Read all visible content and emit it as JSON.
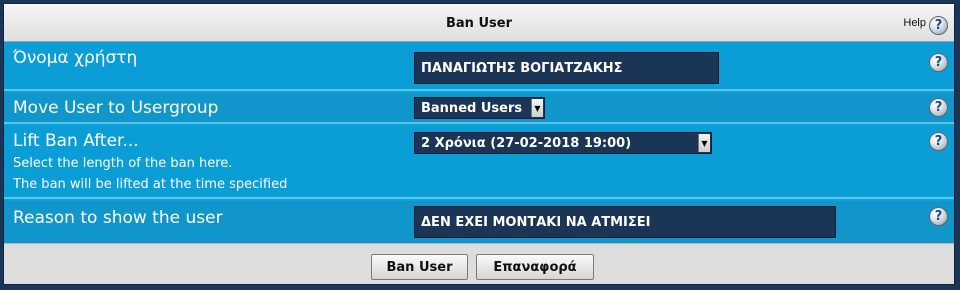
{
  "header": {
    "title": "Ban User",
    "help_label": "Help"
  },
  "icons": {
    "help": "question-mark-icon",
    "dropdown": "chevron-down-icon"
  },
  "rows": {
    "username": {
      "label": "Όνομα χρήστη",
      "value": "ΠΑΝΑΓΙΩΤΗΣ ΒΟΓΙΑΤΖΑΚΗΣ"
    },
    "usergroup": {
      "label": "Move User to Usergroup",
      "selected": "Banned Users"
    },
    "lift_ban": {
      "label": "Lift Ban After...",
      "selected": "2 Χρόνια (27-02-2018 19:00)",
      "desc_line1": "Select the length of the ban here.",
      "desc_line2": "The ban will be lifted at the time specified"
    },
    "reason": {
      "label": "Reason to show the user",
      "value": "ΔΕΝ ΕΧΕΙ ΜΟΝΤΑΚΙ ΝΑ ΑΤΜΙΣΕΙ"
    }
  },
  "footer": {
    "submit_label": "Ban User",
    "reset_label": "Επαναφορά"
  },
  "colors": {
    "panel_bg": "#0da1d9",
    "field_bg": "#1a3556",
    "header_bg": "#e8e8e8",
    "footer_bg": "#dddddd"
  }
}
